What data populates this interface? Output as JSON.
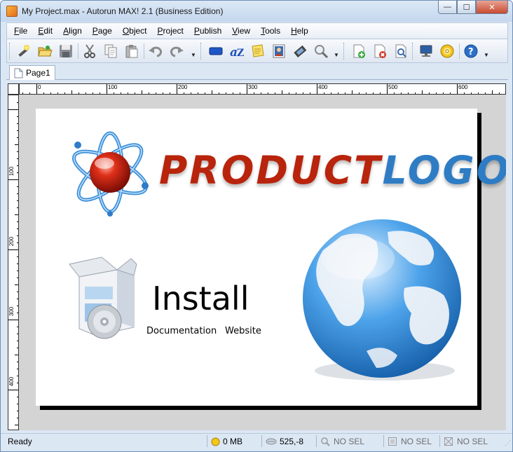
{
  "window": {
    "title": "My Project.max - Autorun MAX! 2.1 (Business Edition)",
    "min_glyph": "—",
    "max_glyph": "☐",
    "close_glyph": "✕"
  },
  "menu": [
    {
      "first": "F",
      "rest": "ile"
    },
    {
      "first": "E",
      "rest": "dit"
    },
    {
      "first": "A",
      "rest": "lign"
    },
    {
      "first": "P",
      "rest": "age"
    },
    {
      "first": "O",
      "rest": "bject"
    },
    {
      "first": "P",
      "rest": "roject"
    },
    {
      "first": "P",
      "rest": "ublish"
    },
    {
      "first": "V",
      "rest": "iew"
    },
    {
      "first": "T",
      "rest": "ools"
    },
    {
      "first": "H",
      "rest": "elp"
    }
  ],
  "toolbar_icons": [
    "wizard-icon",
    "open-icon",
    "save-icon",
    "cut-icon",
    "copy-icon",
    "paste-icon",
    "undo-icon",
    "redo-icon",
    "button-object-icon",
    "text-object-icon",
    "note-object-icon",
    "image-object-icon",
    "video-object-icon",
    "search-object-icon",
    "new-page-icon",
    "delete-page-icon",
    "preview-page-icon",
    "test-run-icon",
    "burn-cd-icon",
    "help-icon"
  ],
  "tabs": [
    {
      "label": "Page1"
    }
  ],
  "ruler": {
    "h_labels": [
      "0",
      "100",
      "200",
      "300",
      "400",
      "500",
      "600"
    ],
    "v_labels": [
      "100",
      "200",
      "300",
      "400"
    ]
  },
  "design": {
    "logo_product": "PRODUCT",
    "logo_logo": "LOGO",
    "install": "Install",
    "documentation": "Documentation",
    "website": "Website",
    "colors": {
      "product": "#b8240c",
      "logo": "#2e7cc4"
    }
  },
  "status": {
    "ready": "Ready",
    "memory": "0 MB",
    "coords": "525,-8",
    "sel1": "NO SEL",
    "sel2": "NO SEL",
    "sel3": "NO SEL"
  }
}
